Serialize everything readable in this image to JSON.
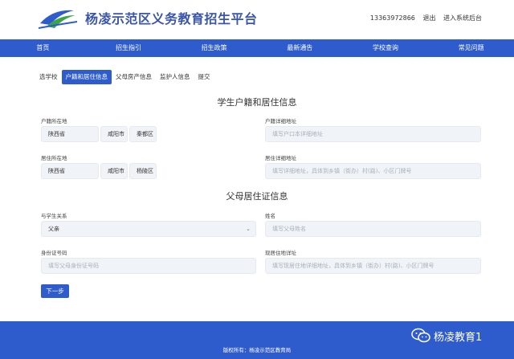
{
  "header": {
    "site_title": "杨凌示范区义务教育招生平台",
    "phone": "13363972866",
    "logout": "退出",
    "admin": "进入系统后台"
  },
  "nav": [
    "首页",
    "招生指引",
    "招生政策",
    "最新通告",
    "学校查询",
    "常见问题"
  ],
  "tabs": [
    "选学校",
    "户籍和居住信息",
    "父母房产信息",
    "监护人信息",
    "提交"
  ],
  "active_tab": 1,
  "sections": {
    "household": "学生户籍和居住信息",
    "parent": "父母居住证信息"
  },
  "household": {
    "hukou_label": "户籍所在地",
    "hukou_province": "陕西省",
    "hukou_city": "咸阳市",
    "hukou_district": "秦都区",
    "hukou_detail_label": "户籍详细地址",
    "hukou_detail_placeholder": "填写户口本详细地址",
    "residence_label": "居住所在地",
    "residence_province": "陕西省",
    "residence_city": "咸阳市",
    "residence_district": "杨陵区",
    "residence_detail_label": "居住详细地址",
    "residence_detail_placeholder": "填写详细地址，具体到乡镇（街办）村(路)、小区门牌号"
  },
  "parent": {
    "relation_label": "与学生关系",
    "relation_value": "父亲",
    "name_label": "姓名",
    "name_placeholder": "填写父母姓名",
    "id_label": "身份证号码",
    "id_placeholder": "填写父母身份证号码",
    "address_label": "现居住地详址",
    "address_placeholder": "填写现居住地详细地址，具体到乡镇（街办）村(路)、小区门牌号"
  },
  "next_button": "下一步",
  "footer": {
    "copyright": "版权所有：杨凌示范区教育局",
    "wechat_name": "杨凌教育1"
  },
  "colors": {
    "primary": "#2f5ccc",
    "title": "#3a56a8",
    "input_bg": "#f0f3f7",
    "logo_green": "#3ba547"
  },
  "icons": {
    "logo": "school-logo-icon",
    "select": "chevron-down-icon",
    "wechat": "wechat-icon"
  }
}
